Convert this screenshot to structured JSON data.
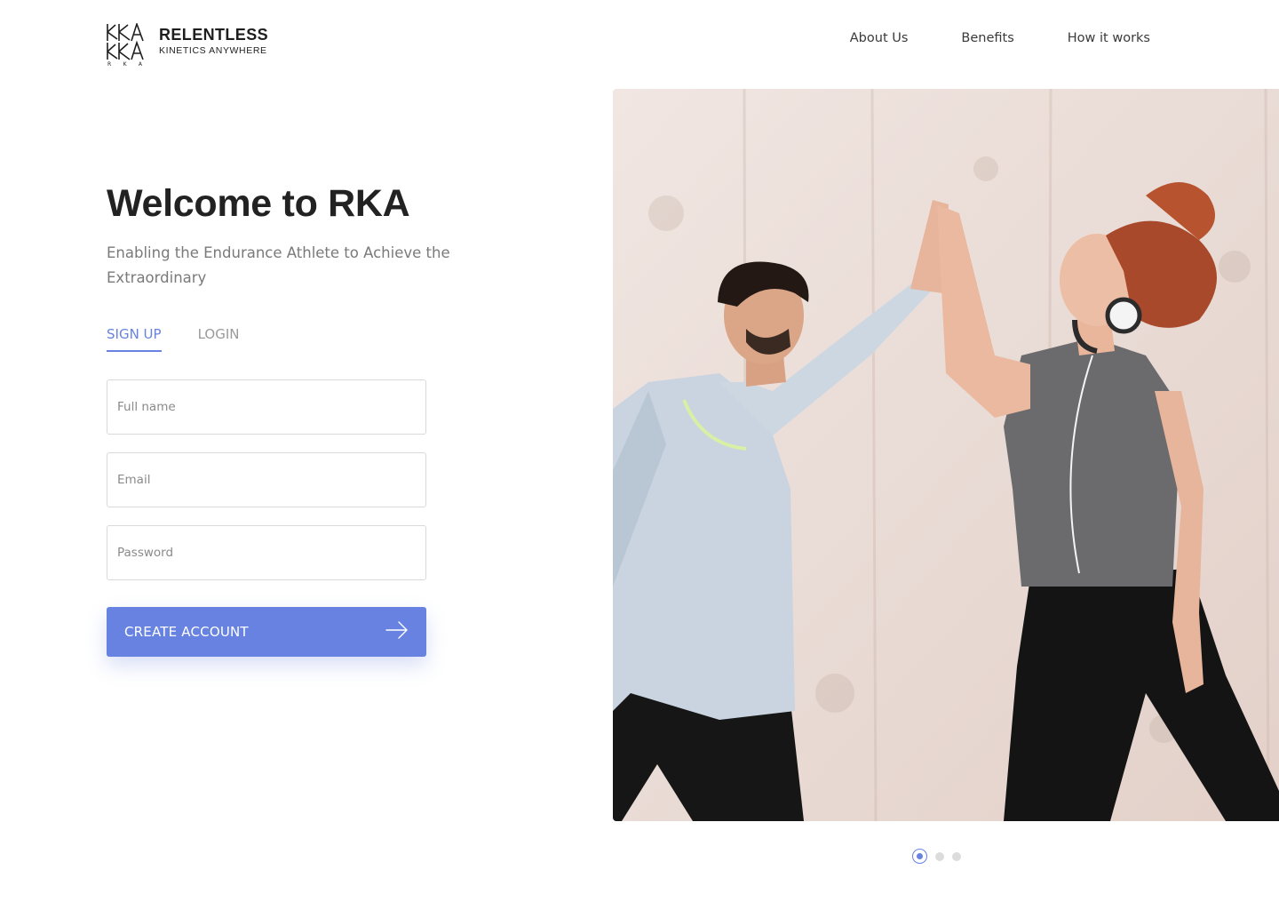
{
  "brand": {
    "name": "RELENTLESS",
    "tagline": "KINETICS ANYWHERE",
    "letters": [
      "R",
      "K",
      "A"
    ]
  },
  "nav": {
    "items": [
      {
        "label": "About Us"
      },
      {
        "label": "Benefits"
      },
      {
        "label": "How it works"
      }
    ]
  },
  "hero_text": {
    "title": "Welcome to RKA",
    "subtitle": "Enabling the Endurance Athlete to Achieve the Extraordinary"
  },
  "auth": {
    "tabs": [
      {
        "label": "SIGN UP",
        "active": true
      },
      {
        "label": "LOGIN",
        "active": false
      }
    ],
    "fields": {
      "full_name": {
        "placeholder": "Full name",
        "value": ""
      },
      "email": {
        "placeholder": "Email",
        "value": ""
      },
      "password": {
        "placeholder": "Password",
        "value": ""
      }
    },
    "submit_label": "CREATE ACCOUNT",
    "submit_icon": "arrow-right-icon"
  },
  "carousel": {
    "image_alt": "Two athletes giving a high five",
    "slide_count": 3,
    "active_index": 0
  },
  "colors": {
    "accent": "#6782e1",
    "text_dark": "#222222",
    "text_muted": "#7a7a7a",
    "border": "#d9d9d9"
  }
}
